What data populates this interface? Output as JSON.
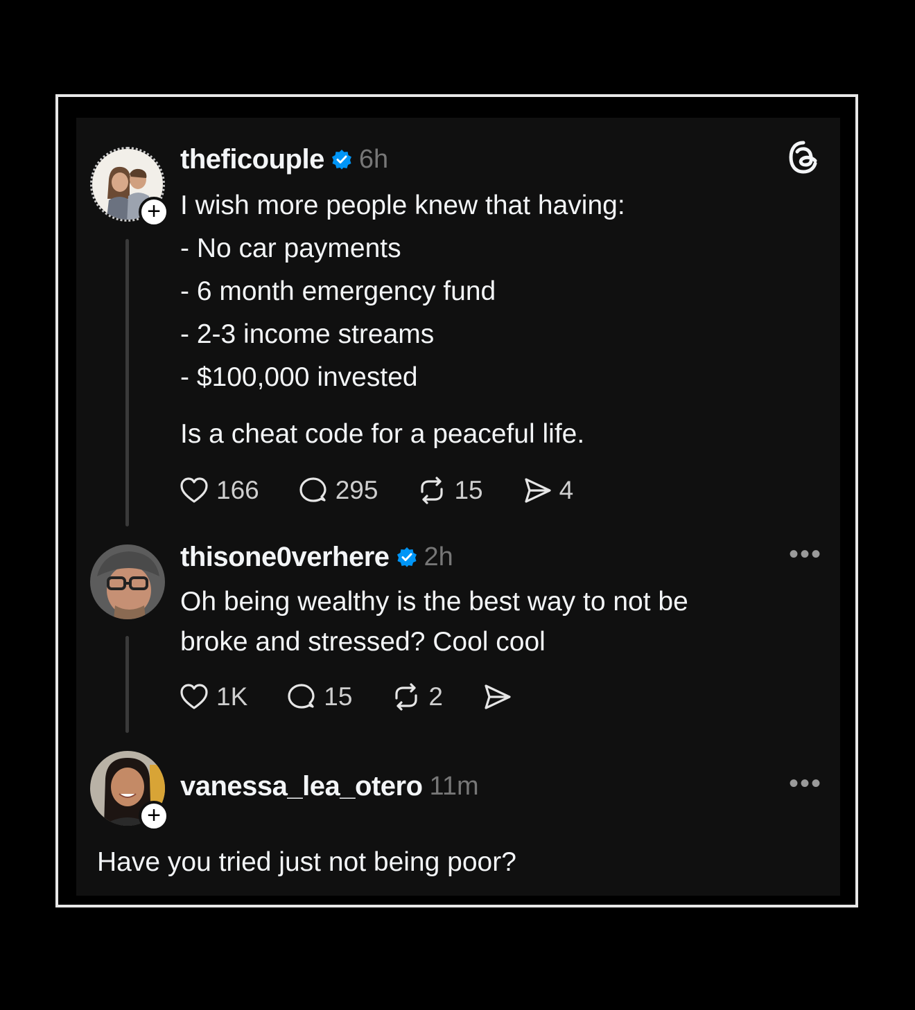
{
  "posts": [
    {
      "username": "theficouple",
      "verified": true,
      "time": "6h",
      "lines": [
        "I wish more people knew that having:",
        "- No car payments",
        "- 6 month emergency fund",
        "- 2-3 income streams",
        "- $100,000 invested",
        "",
        "Is a cheat code for a peaceful life."
      ],
      "likes": "166",
      "replies": "295",
      "reposts": "15",
      "shares": "4"
    },
    {
      "username": "thisone0verhere",
      "verified": true,
      "time": "2h",
      "lines": [
        "Oh being wealthy is the best way to not be",
        "broke and stressed? Cool cool"
      ],
      "likes": "1K",
      "replies": "15",
      "reposts": "2",
      "shares": ""
    },
    {
      "username": "vanessa_lea_otero",
      "verified": false,
      "time": "11m",
      "lines": [
        "Have you tried just not being poor?"
      ]
    }
  ],
  "icons": {
    "threads_logo": "threads-logo-icon",
    "like": "heart-icon",
    "reply": "comment-icon",
    "repost": "repost-icon",
    "share": "send-icon",
    "more": "more-options-icon",
    "verified": "verified-badge-icon",
    "follow": "plus-icon"
  },
  "colors": {
    "background": "#101010",
    "verified": "#0095f6",
    "muted": "#777777"
  }
}
